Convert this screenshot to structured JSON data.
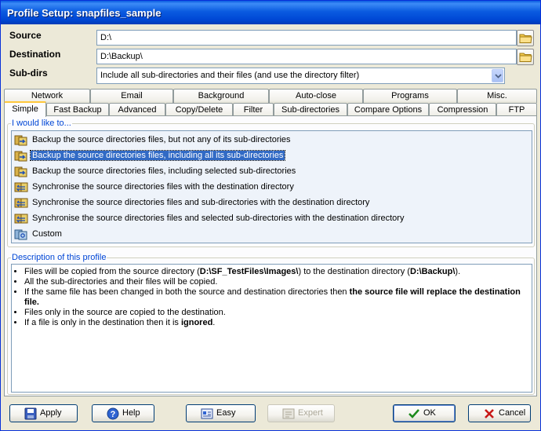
{
  "window": {
    "title": "Profile Setup: snapfiles_sample"
  },
  "form": {
    "source_label": "Source",
    "source_value": "D:\\",
    "destination_label": "Destination",
    "destination_value": "D:\\Backup\\",
    "subdirs_label": "Sub-dirs",
    "subdirs_value": "Include all sub-directories and their files (and use the directory filter)"
  },
  "tabs_top": [
    "Network",
    "Email",
    "Background",
    "Auto-close",
    "Programs",
    "Misc."
  ],
  "tabs_bottom": [
    "Simple",
    "Fast Backup",
    "Advanced",
    "Copy/Delete",
    "Filter",
    "Sub-directories",
    "Compare Options",
    "Compression",
    "FTP"
  ],
  "active_tab": "Simple",
  "options_group": {
    "legend": "I would like to...",
    "items": [
      "Backup the source directories files, but not any of its sub-directories",
      "Backup the source directories files, including all its sub-directories",
      "Backup the source directories files, including selected sub-directories",
      "Synchronise the source directories files with the destination directory",
      "Synchronise the source directories files and sub-directories with the destination directory",
      "Synchronise the source directories files and selected sub-directories with the destination directory",
      "Custom"
    ],
    "selected_index": 1
  },
  "description_group": {
    "legend": "Description of this profile",
    "line1_a": "Files will be copied from the source directory (",
    "line1_b": "D:\\SF_TestFiles\\Images\\",
    "line1_c": ") to the destination directory (",
    "line1_d": "D:\\Backup\\",
    "line1_e": ").",
    "line2": "All the sub-directories and their files will be copied.",
    "line3_a": "If the same file has been changed in both the source and destination directories then ",
    "line3_b": "the source file will replace the destination file.",
    "line4": "Files only in the source are copied to the destination.",
    "line5_a": "If a file is only in the destination then it is ",
    "line5_b": "ignored",
    "line5_c": "."
  },
  "buttons": {
    "apply": "Apply",
    "help": "Help",
    "easy": "Easy",
    "expert": "Expert",
    "ok": "OK",
    "cancel": "Cancel"
  },
  "icons": {
    "folder": "folder-icon",
    "dropdown": "chevron-down-icon",
    "option": "copy-files-icon",
    "apply": "floppy-disk-icon",
    "help": "help-icon",
    "easy": "wizard-icon",
    "expert": "expert-icon",
    "ok": "checkmark-icon",
    "cancel": "cross-icon"
  }
}
